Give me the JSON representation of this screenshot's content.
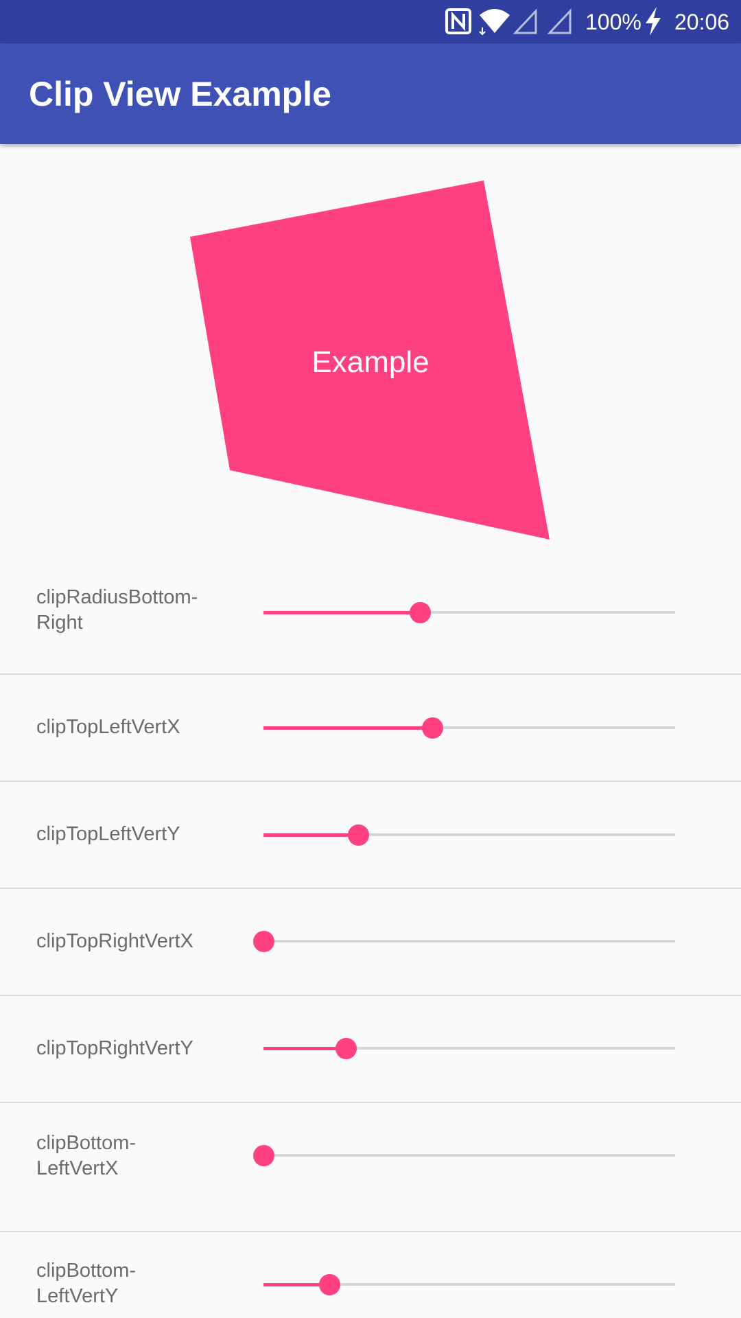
{
  "status_bar": {
    "battery_text": "100%",
    "time": "20:06",
    "icons": [
      "nfc-icon",
      "wifi-icon",
      "signal-icon",
      "signal-icon",
      "charging-icon"
    ]
  },
  "app_bar": {
    "title": "Clip View Example"
  },
  "preview": {
    "label": "Example",
    "fill_color": "#FF4081"
  },
  "sliders": [
    {
      "label": "clipRadiusBottom-\nRight",
      "value": 0.38
    },
    {
      "label": "clipTopLeftVertX",
      "value": 0.41
    },
    {
      "label": "clipTopLeftVertY",
      "value": 0.23
    },
    {
      "label": "clipTopRightVertX",
      "value": 0.0
    },
    {
      "label": "clipTopRightVertY",
      "value": 0.2
    },
    {
      "label": "clipBottom-\nLeftVertX",
      "value": 0.0
    },
    {
      "label": "clipBottom-\nLeftVertY",
      "value": 0.16
    }
  ],
  "colors": {
    "status_bar": "#303F9F",
    "app_bar": "#3F51B5",
    "accent": "#FF4081",
    "background": "#FAFAFA"
  }
}
